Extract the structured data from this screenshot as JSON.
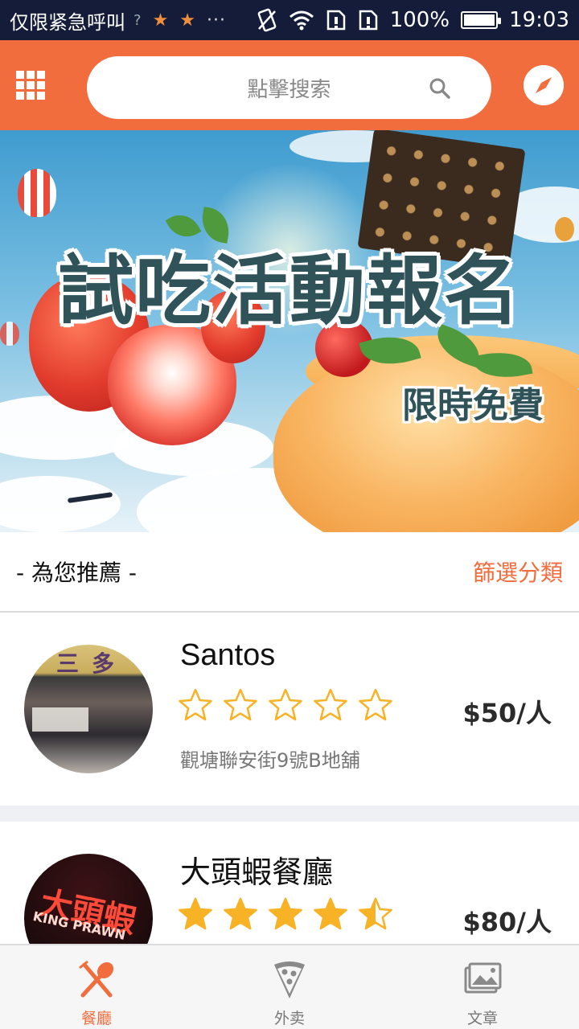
{
  "status_bar": {
    "carrier_text": "仅限紧急呼叫",
    "sim_marker": "?",
    "notif_star_1": "★",
    "notif_star_2": "★",
    "more": "···",
    "battery_text": "100%",
    "time": "19:03"
  },
  "header": {
    "search_placeholder": "點擊搜索"
  },
  "banner": {
    "title": "試吃活動報名",
    "subtitle": "限時免費"
  },
  "section": {
    "title": "- 為您推薦 -",
    "filter_label": "篩選分類"
  },
  "restaurants": [
    {
      "name": "Santos",
      "rating": 0,
      "max_rating": 5,
      "price": "$50/人",
      "address": "觀塘聯安街9號B地舖",
      "avatar_sign_text": "三多"
    },
    {
      "name": "大頭蝦餐廳",
      "rating": 4.5,
      "max_rating": 5,
      "price": "$80/人",
      "avatar_sign_text": "大頭蝦",
      "avatar_sign_sub": "KING PRAWN"
    }
  ],
  "bottom_nav": {
    "items": [
      {
        "label": "餐廳",
        "icon": "fork-spoon-icon",
        "active": true
      },
      {
        "label": "外卖",
        "icon": "pizza-slice-icon",
        "active": false
      },
      {
        "label": "文章",
        "icon": "gallery-icon",
        "active": false
      }
    ]
  },
  "colors": {
    "accent": "#f26d3d",
    "star": "#f7b225",
    "status_bar_bg": "#141c3a"
  }
}
